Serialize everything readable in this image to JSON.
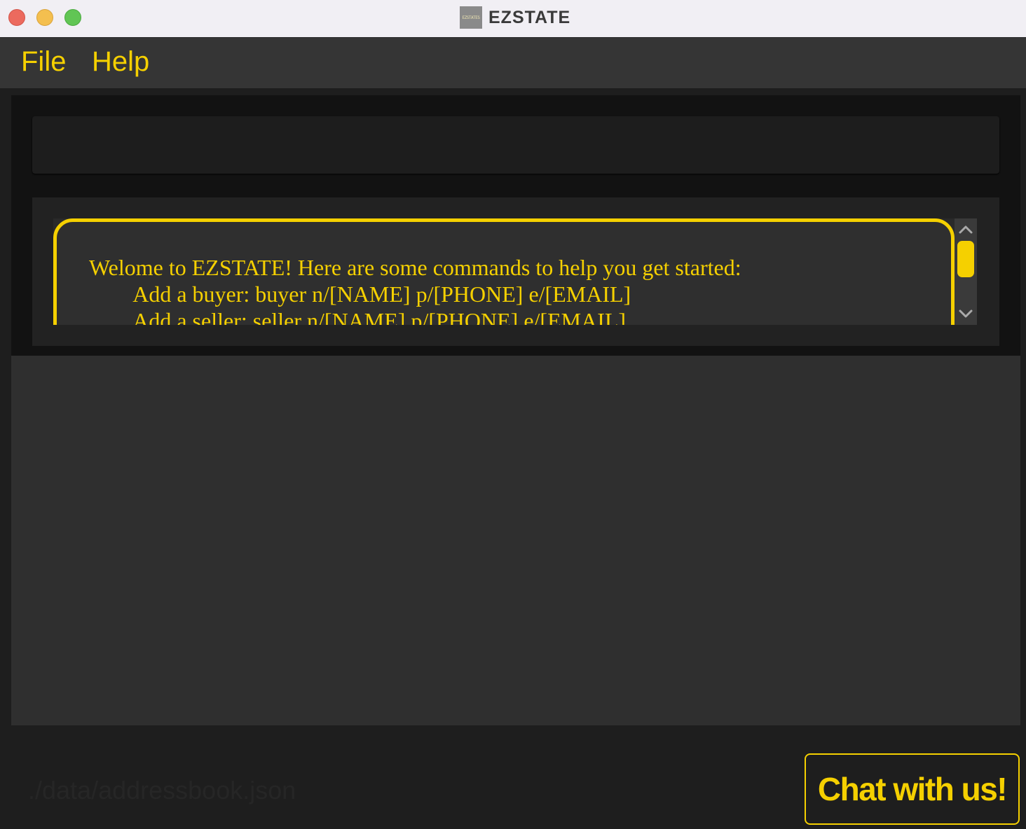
{
  "window": {
    "title": "EZSTATE",
    "icon_text": "EZSTATES"
  },
  "menu": {
    "items": [
      {
        "label": "File"
      },
      {
        "label": "Help"
      }
    ]
  },
  "command_box": {
    "value": ""
  },
  "result_display": {
    "text": "Welome to EZSTATE! Here are some commands to help you get started:\n        Add a buyer: buyer n/[NAME] p/[PHONE] e/[EMAIL]\n        Add a seller: seller n/[NAME] p/[PHONE] e/[EMAIL]"
  },
  "status_bar": {
    "path": "./data/addressbook.json"
  },
  "chat_button": {
    "label": "Chat with us!"
  },
  "colors": {
    "accent": "#f5d000",
    "background": "#1e1e1e",
    "panel": "#2f2f2f"
  }
}
